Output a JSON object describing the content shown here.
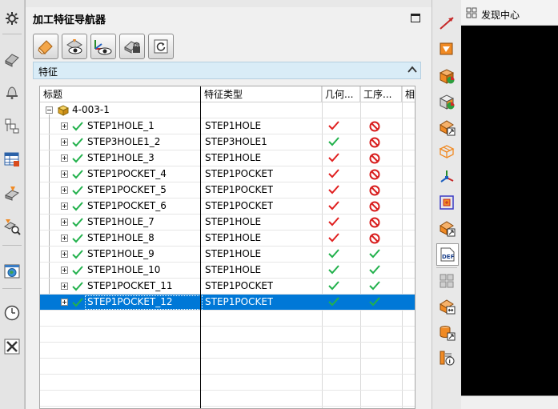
{
  "panel": {
    "title": "加工特征导航器",
    "section_label": "特征"
  },
  "columns": [
    "标题",
    "特征类型",
    "几何...",
    "工序...",
    "相"
  ],
  "root": {
    "label": "4-003-1"
  },
  "rows": [
    {
      "name": "STEP1HOLE_1",
      "type": "STEP1HOLE",
      "geometry": "red-check",
      "operation": "no"
    },
    {
      "name": "STEP3HOLE1_2",
      "type": "STEP3HOLE1",
      "geometry": "green-check",
      "operation": "no"
    },
    {
      "name": "STEP1HOLE_3",
      "type": "STEP1HOLE",
      "geometry": "red-check",
      "operation": "no"
    },
    {
      "name": "STEP1POCKET_4",
      "type": "STEP1POCKET",
      "geometry": "red-check",
      "operation": "no"
    },
    {
      "name": "STEP1POCKET_5",
      "type": "STEP1POCKET",
      "geometry": "red-check",
      "operation": "no"
    },
    {
      "name": "STEP1POCKET_6",
      "type": "STEP1POCKET",
      "geometry": "red-check",
      "operation": "no"
    },
    {
      "name": "STEP1HOLE_7",
      "type": "STEP1HOLE",
      "geometry": "red-check",
      "operation": "no"
    },
    {
      "name": "STEP1HOLE_8",
      "type": "STEP1HOLE",
      "geometry": "red-check",
      "operation": "no"
    },
    {
      "name": "STEP1HOLE_9",
      "type": "STEP1HOLE",
      "geometry": "green-check",
      "operation": "green-check"
    },
    {
      "name": "STEP1HOLE_10",
      "type": "STEP1HOLE",
      "geometry": "green-check",
      "operation": "green-check"
    },
    {
      "name": "STEP1POCKET_11",
      "type": "STEP1POCKET",
      "geometry": "green-check",
      "operation": "green-check"
    },
    {
      "name": "STEP1POCKET_12",
      "type": "STEP1POCKET",
      "geometry": "green-check",
      "operation": "green-check",
      "selected": true
    }
  ],
  "right_panel": {
    "discover_label": "发现中心"
  },
  "colors": {
    "selection": "#0078d7",
    "check_green": "#22b14c",
    "check_red": "#e02020",
    "prohibited_red": "#d81e1e"
  }
}
